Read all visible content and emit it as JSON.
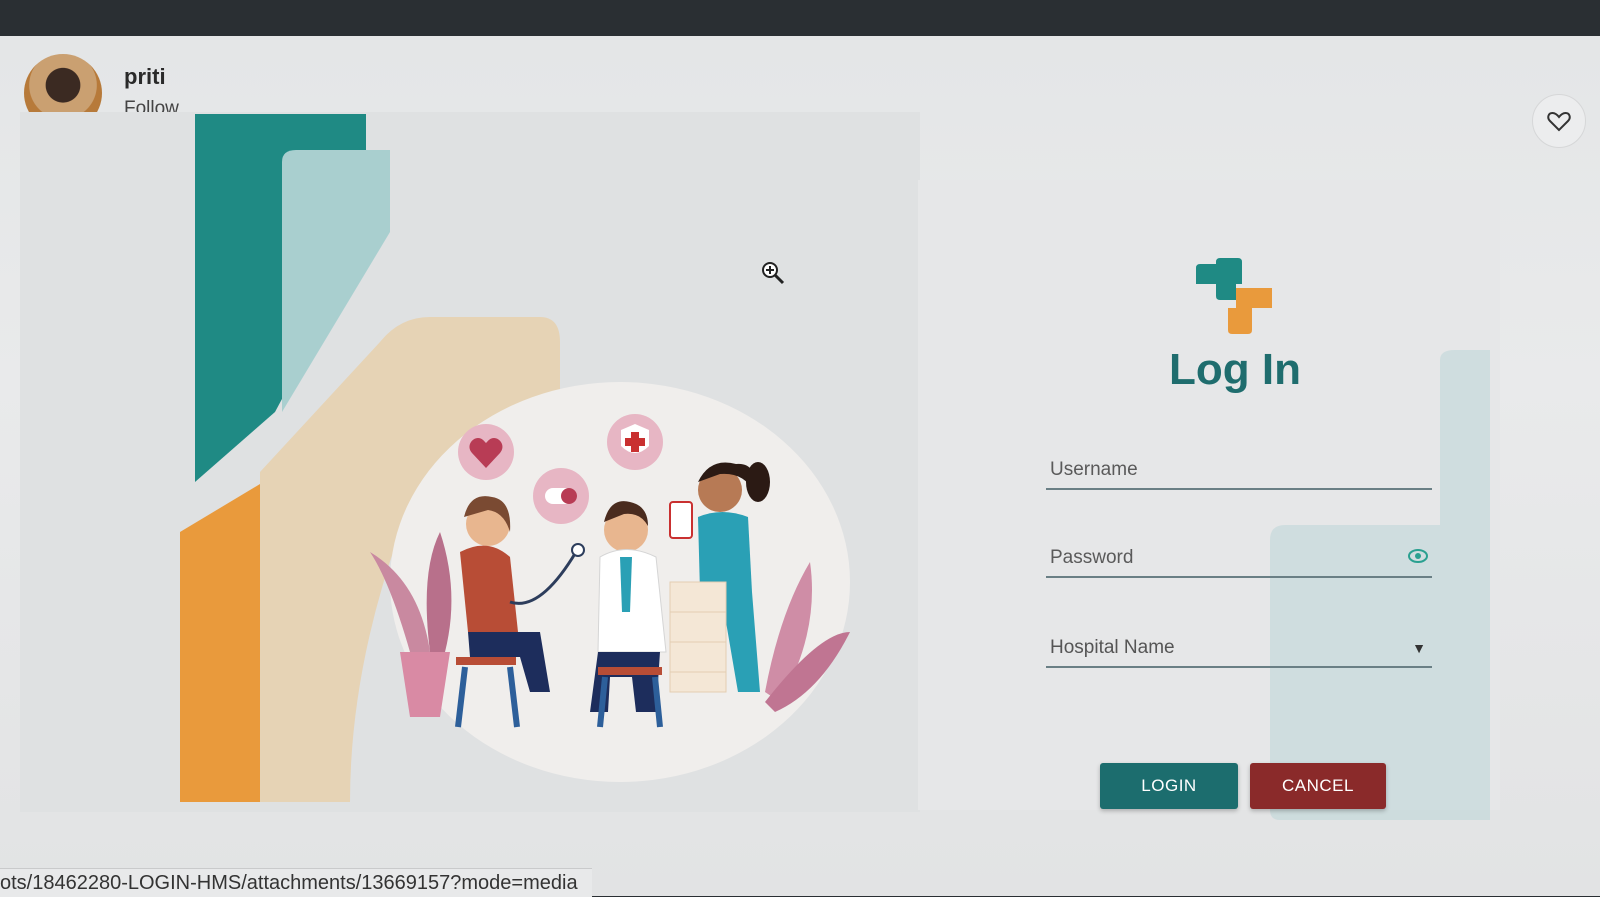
{
  "header": {
    "username": "priti",
    "follow_label": "Follow",
    "like_icon": "heart-icon"
  },
  "login": {
    "title": "Log In",
    "username_placeholder": "Username",
    "password_placeholder": "Password",
    "hospital_placeholder": "Hospital Name",
    "login_label": "LOGIN",
    "cancel_label": "CANCEL"
  },
  "status_bar": {
    "url": "ots/18462280-LOGIN-HMS/attachments/13669157?mode=media"
  },
  "colors": {
    "teal": "#1c6d6e",
    "cancel_red": "#8a2a2a",
    "orange": "#e99a3c"
  }
}
